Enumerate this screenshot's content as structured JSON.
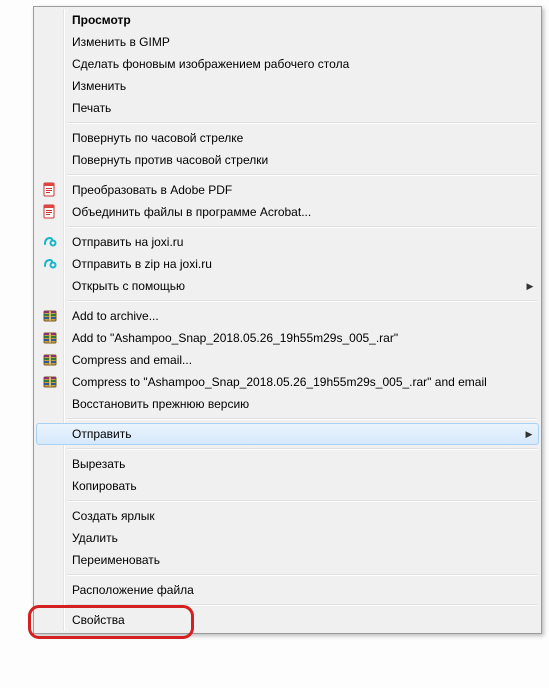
{
  "menu": {
    "items": [
      {
        "label": "Просмотр",
        "bold": true,
        "icon": null
      },
      {
        "label": "Изменить в GIMP",
        "icon": null
      },
      {
        "label": "Сделать фоновым изображением рабочего стола",
        "icon": null
      },
      {
        "label": "Изменить",
        "icon": null
      },
      {
        "label": "Печать",
        "icon": null
      },
      {
        "type": "sep"
      },
      {
        "label": "Повернуть по часовой стрелке",
        "icon": null
      },
      {
        "label": "Повернуть против часовой стрелки",
        "icon": null
      },
      {
        "type": "sep"
      },
      {
        "label": "Преобразовать в Adobe PDF",
        "icon": "pdf"
      },
      {
        "label": "Объединить файлы в программе Acrobat...",
        "icon": "pdf"
      },
      {
        "type": "sep"
      },
      {
        "label": "Отправить на joxi.ru",
        "icon": "joxi"
      },
      {
        "label": "Отправить в zip на joxi.ru",
        "icon": "joxi"
      },
      {
        "label": "Открыть с помощью",
        "icon": null,
        "submenu": true
      },
      {
        "type": "sep"
      },
      {
        "label": "Add to archive...",
        "icon": "rar"
      },
      {
        "label": "Add to \"Ashampoo_Snap_2018.05.26_19h55m29s_005_.rar\"",
        "icon": "rar"
      },
      {
        "label": "Compress and email...",
        "icon": "rar"
      },
      {
        "label": "Compress to \"Ashampoo_Snap_2018.05.26_19h55m29s_005_.rar\" and email",
        "icon": "rar"
      },
      {
        "label": "Восстановить прежнюю версию",
        "icon": null
      },
      {
        "type": "sep"
      },
      {
        "label": "Отправить",
        "icon": null,
        "submenu": true,
        "hover": true
      },
      {
        "type": "sep"
      },
      {
        "label": "Вырезать",
        "icon": null
      },
      {
        "label": "Копировать",
        "icon": null
      },
      {
        "type": "sep"
      },
      {
        "label": "Создать ярлык",
        "icon": null
      },
      {
        "label": "Удалить",
        "icon": null
      },
      {
        "label": "Переименовать",
        "icon": null
      },
      {
        "type": "sep"
      },
      {
        "label": "Расположение файла",
        "icon": null
      },
      {
        "type": "sep"
      },
      {
        "label": "Свойства",
        "icon": null,
        "highlight": true
      }
    ]
  }
}
